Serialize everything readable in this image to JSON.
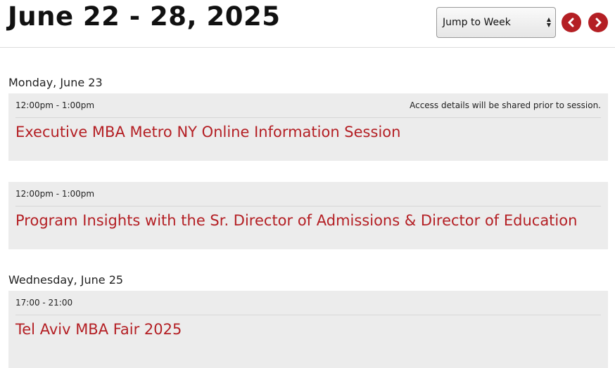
{
  "header": {
    "title": "June 22 - 28, 2025",
    "jump_select": {
      "selected": "Jump to Week"
    },
    "prev_icon": "chevron-left-icon",
    "next_icon": "chevron-right-icon"
  },
  "colors": {
    "accent": "#b41f24",
    "card_bg": "#ececec"
  },
  "days": [
    {
      "heading": "Monday, June 23",
      "events": [
        {
          "time": "12:00pm - 1:00pm",
          "note": "Access details will be shared prior to session.",
          "title": "Executive MBA Metro NY Online Information Session"
        },
        {
          "time": "12:00pm - 1:00pm",
          "note": "",
          "title": "Program Insights with the Sr. Director of Admissions & Director of Education"
        }
      ]
    },
    {
      "heading": "Wednesday, June 25",
      "events": [
        {
          "time": "17:00 - 21:00",
          "note": "",
          "title": "Tel Aviv MBA Fair 2025"
        }
      ]
    }
  ]
}
